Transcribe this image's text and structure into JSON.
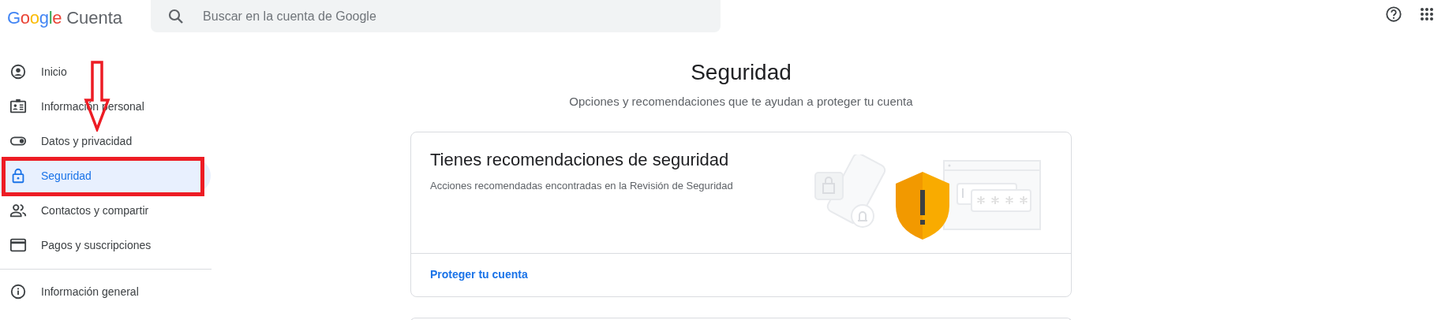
{
  "header": {
    "logo": "Google",
    "product": "Cuenta",
    "search": {
      "placeholder": "Buscar en la cuenta de Google"
    }
  },
  "sidebar": {
    "items": [
      {
        "label": "Inicio",
        "kind": "home",
        "selected": false
      },
      {
        "label": "Información personal",
        "kind": "personal",
        "selected": false
      },
      {
        "label": "Datos y privacidad",
        "kind": "privacy",
        "selected": false
      },
      {
        "label": "Seguridad",
        "kind": "security",
        "selected": true
      },
      {
        "label": "Contactos y compartir",
        "kind": "contacts",
        "selected": false
      },
      {
        "label": "Pagos y suscripciones",
        "kind": "payments",
        "selected": false
      }
    ],
    "footer_items": [
      {
        "label": "Información general",
        "kind": "about",
        "selected": false
      }
    ]
  },
  "page": {
    "title": "Seguridad",
    "subtitle": "Opciones y recomendaciones que te ayudan a proteger tu cuenta"
  },
  "recommendation_card": {
    "title": "Tienes recomendaciones de seguridad",
    "description": "Acciones recomendadas encontradas en la Revisión de Seguridad",
    "link": "Proteger tu cuenta"
  },
  "annotations": {
    "arrow": true,
    "highlight_box": true
  }
}
